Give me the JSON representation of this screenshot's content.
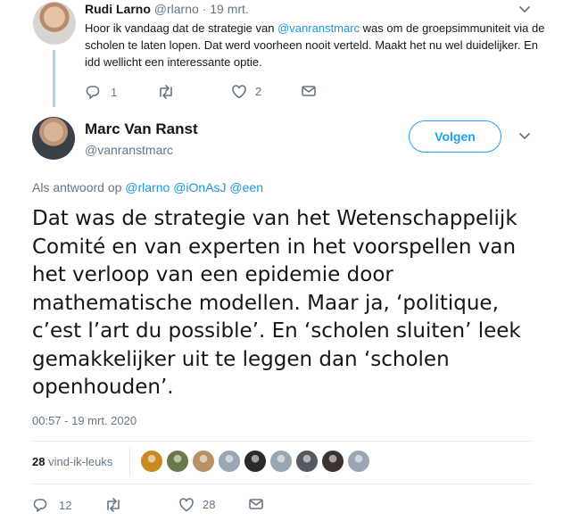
{
  "reply_tweet": {
    "author_name": "Rudi Larno",
    "handle_and_time": "@rlarno · 19 mrt.",
    "text_part1": "Hoor ik vandaag dat de strategie van ",
    "text_mention": "@vanranstmarc",
    "text_part2": " was om de groepsimmuniteit via de scholen te laten lopen. Dat werd voorheen nooit verteld. Maakt het nu wel duidelijker. En idd wellicht een interessante optie.",
    "reply_count": "1",
    "retweet_count": "",
    "like_count": "2"
  },
  "main_tweet": {
    "author_name": "Marc Van Ranst",
    "handle": "@vanranstmarc",
    "follow_label": "Volgen",
    "replying_to_label": "Als antwoord op ",
    "replying_to_mentions": "@rlarno @iOnAsJ @een",
    "text": "Dat was de strategie van het Wetenschappelijk Comité en van experten in het voorspellen van het verloop van een epidemie door mathematische modellen. Maar ja, ‘politique, c’est l’art du possible’. En ‘scholen sluiten’ leek gemakkelijker uit te leggen dan ‘scholen openhouden’.",
    "timestamp": "00:57 - 19 mrt. 2020",
    "likes_count": "28",
    "likes_label": " vind-ik-leuks",
    "reply_count": "12",
    "retweet_count": "",
    "like_count": "28"
  },
  "liker_avatars": [
    {
      "name": "liker-avatar-1",
      "color": "#c98a1e"
    },
    {
      "name": "liker-avatar-2",
      "color": "#6a7a4a"
    },
    {
      "name": "liker-avatar-3",
      "color": "#b8906a"
    },
    {
      "name": "liker-avatar-4",
      "color": "#9aa6b2"
    },
    {
      "name": "liker-avatar-5",
      "color": "#2a2a2a"
    },
    {
      "name": "liker-avatar-6",
      "color": "#9aa6b2"
    },
    {
      "name": "liker-avatar-7",
      "color": "#555a60"
    },
    {
      "name": "liker-avatar-8",
      "color": "#3a3330"
    },
    {
      "name": "liker-avatar-9",
      "color": "#9aa6b2"
    }
  ],
  "colors": {
    "accent": "#1da1f2",
    "link": "#1b95e0",
    "muted_text": "#657786",
    "thread_line": "#a6d4f2"
  },
  "icons": [
    "chevron-down-icon",
    "reply-icon",
    "retweet-icon",
    "like-icon",
    "message-icon"
  ]
}
